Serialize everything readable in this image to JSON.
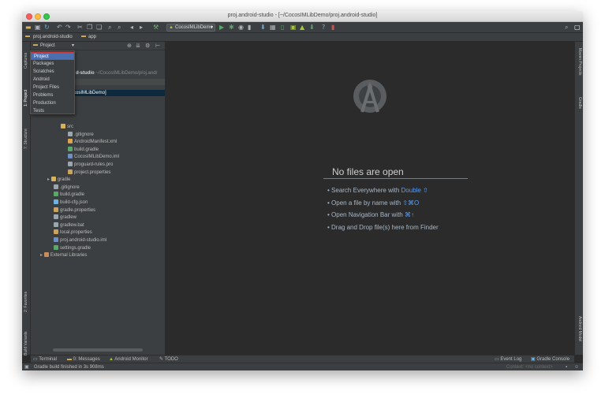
{
  "window": {
    "title": "proj.android-studio - [~/CocosIMLibDemo/proj.android-studio]"
  },
  "toolbar": {
    "run_config": "CocosIMLibDemo"
  },
  "breadcrumb": {
    "project": "proj.android-studio",
    "module": "app"
  },
  "project_panel": {
    "view_label": "Project",
    "root_name": "proj.android-studio",
    "root_path": "~/CocosIMLibDemo/proj.andr",
    "selected_suffix": "cosIMLibDemo]",
    "dropdown": [
      "Project",
      "Packages",
      "Scratches",
      "Android",
      "Project Files",
      "Problems",
      "Production",
      "Tests"
    ],
    "tree": [
      {
        "label": "src",
        "indent": 2,
        "type": "folder"
      },
      {
        "label": ".gitignore",
        "indent": 3,
        "type": "file"
      },
      {
        "label": "AndroidManifest.xml",
        "indent": 3,
        "type": "xml"
      },
      {
        "label": "build.gradle",
        "indent": 3,
        "type": "gradle"
      },
      {
        "label": "CocosIMLibDemo.iml",
        "indent": 3,
        "type": "iml"
      },
      {
        "label": "proguard-rules.pro",
        "indent": 3,
        "type": "file"
      },
      {
        "label": "project.properties",
        "indent": 3,
        "type": "props"
      },
      {
        "label": "gradle",
        "indent": 1,
        "type": "folder",
        "arrow": true
      },
      {
        "label": ".gitignore",
        "indent": 1,
        "type": "file"
      },
      {
        "label": "build.gradle",
        "indent": 1,
        "type": "gradle"
      },
      {
        "label": "build-cfg.json",
        "indent": 1,
        "type": "json"
      },
      {
        "label": "gradle.properties",
        "indent": 1,
        "type": "props"
      },
      {
        "label": "gradlew",
        "indent": 1,
        "type": "file"
      },
      {
        "label": "gradlew.bat",
        "indent": 1,
        "type": "file"
      },
      {
        "label": "local.properties",
        "indent": 1,
        "type": "props"
      },
      {
        "label": "proj.android-studio.iml",
        "indent": 1,
        "type": "iml"
      },
      {
        "label": "settings.gradle",
        "indent": 1,
        "type": "gradle"
      },
      {
        "label": "External Libraries",
        "indent": 0,
        "type": "lib",
        "arrow": true
      }
    ]
  },
  "left_tabs": {
    "captures": "Captures",
    "project": "1: Project",
    "structure": "7: Structure",
    "favorites": "2: Favorites",
    "build_variants": "Build Variants"
  },
  "right_tabs": {
    "maven": "Maven Projects",
    "gradle": "Gradle",
    "android_model": "Android Model"
  },
  "editor": {
    "empty_title": "No files are open",
    "hints": [
      {
        "text": "Search Everywhere with ",
        "key": "Double ⇧"
      },
      {
        "text": "Open a file by name with ",
        "key": "⇧⌘O"
      },
      {
        "text": "Open Navigation Bar with ",
        "key": "⌘↑"
      },
      {
        "text": "Drag and Drop file(s) here from Finder",
        "key": ""
      }
    ]
  },
  "bottom_tools": {
    "terminal": "Terminal",
    "messages": "0: Messages",
    "android_monitor": "Android Monitor",
    "todo": "TODO",
    "event_log": "Event Log",
    "gradle_console": "Gradle Console"
  },
  "status": {
    "message": "Gradle build finished in 3s 908ms",
    "context": "Context: <no context>"
  },
  "colors": {
    "accent": "#4b6eaf",
    "hint_key": "#589df6",
    "background": "#2b2b2b"
  }
}
